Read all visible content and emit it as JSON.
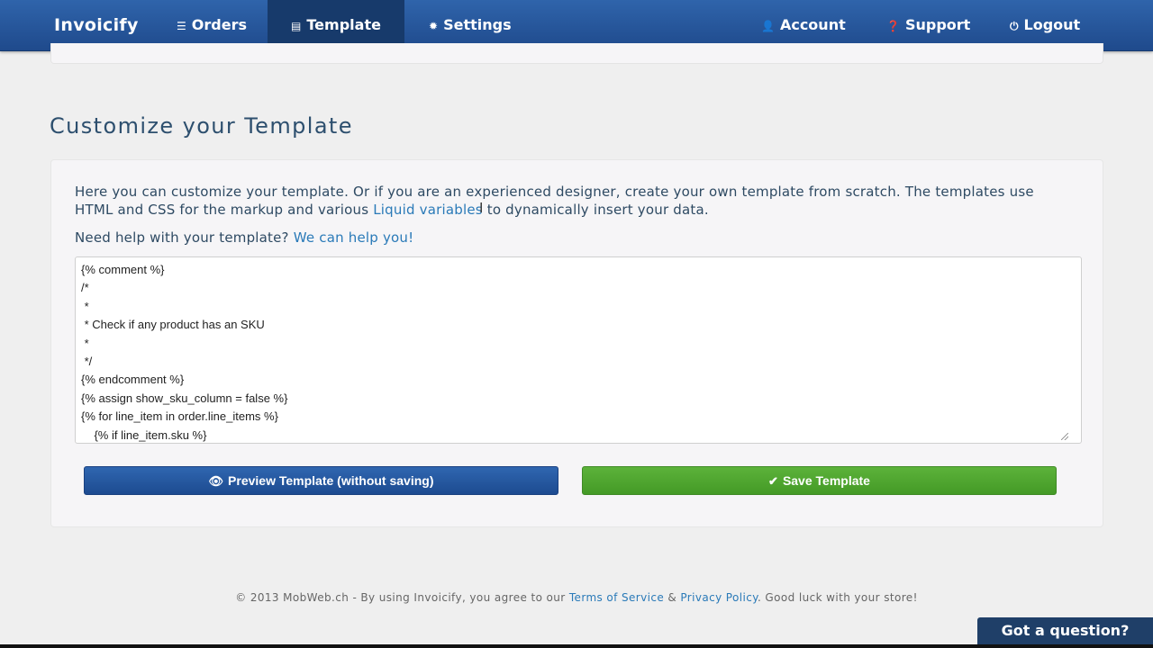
{
  "nav": {
    "brand": "Invoicify",
    "orders": "Orders",
    "template": "Template",
    "settings": "Settings",
    "account": "Account",
    "support": "Support",
    "logout": "Logout"
  },
  "page": {
    "title": "Customize your Template"
  },
  "intro": {
    "part1": "Here you can customize your template. Or if you are an experienced designer, create your own template from scratch. The templates use HTML and CSS for the markup and various ",
    "link": "Liquid variables",
    "part2": " to dynamically insert your data."
  },
  "help": {
    "text": "Need help with your template? ",
    "link": "We can help you!"
  },
  "editor": {
    "content": "{% comment %}\n/*\n *\n * Check if any product has an SKU\n *\n */\n{% endcomment %}\n{% assign show_sku_column = false %}\n{% for line_item in order.line_items %}\n    {% if line_item.sku %}"
  },
  "buttons": {
    "preview": "Preview Template (without saving)",
    "save": "Save Template"
  },
  "footer": {
    "prefix": "© 2013 MobWeb.ch - By using Invoicify, you agree to our ",
    "terms": "Terms of Service",
    "amp": " & ",
    "privacy": "Privacy Policy",
    "suffix": ". Good luck with your store!"
  },
  "chat": {
    "label": "Got a question?"
  },
  "icons": {
    "orders": "list-icon",
    "template": "document-icon",
    "settings": "gear-icon",
    "account": "user-icon",
    "support": "question-circle-icon",
    "logout": "power-icon",
    "preview": "eye-icon",
    "save": "checkmark-icon"
  },
  "colors": {
    "navbar": "#2458a0",
    "active_tab": "#173a6b",
    "link": "#2a7ab8",
    "preview_button": "#2458a0",
    "save_button": "#4fa62f",
    "chat_tab": "#1f3f68"
  }
}
